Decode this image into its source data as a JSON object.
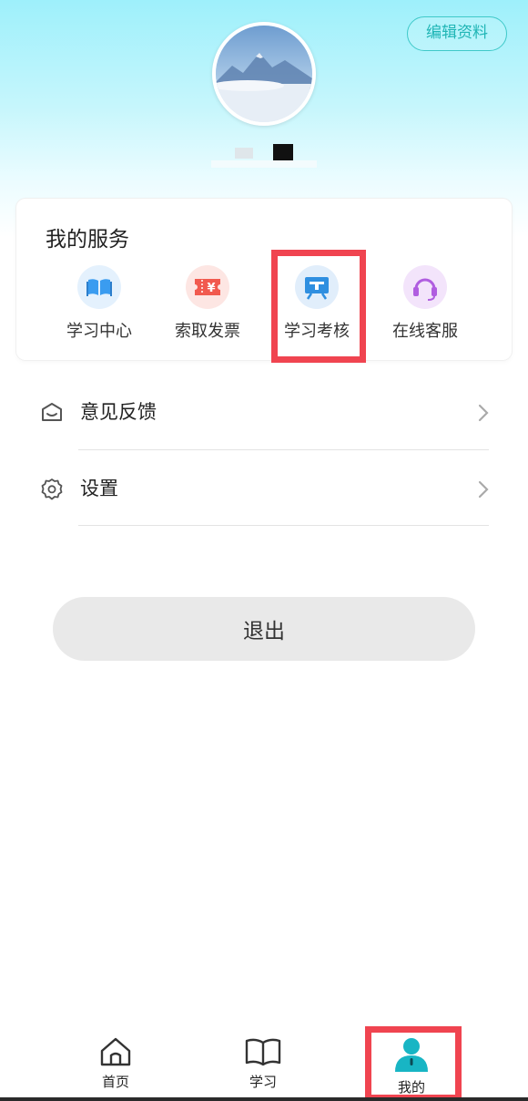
{
  "header": {
    "edit_profile_label": "编辑资料"
  },
  "services": {
    "title": "我的服务",
    "items": [
      {
        "label": "学习中心",
        "icon": "book-icon",
        "color": "#3a9cf0"
      },
      {
        "label": "索取发票",
        "icon": "invoice-ticket-icon",
        "color": "#f15a4f"
      },
      {
        "label": "学习考核",
        "icon": "presentation-board-icon",
        "color": "#2f8fe0"
      },
      {
        "label": "在线客服",
        "icon": "headset-icon",
        "color": "#b05de0"
      }
    ]
  },
  "menu": [
    {
      "label": "意见反馈",
      "icon": "feedback-mail-icon"
    },
    {
      "label": "设置",
      "icon": "gear-icon"
    }
  ],
  "logout_label": "退出",
  "tabbar": {
    "items": [
      {
        "label": "首页",
        "icon": "home-icon"
      },
      {
        "label": "学习",
        "icon": "open-book-icon"
      },
      {
        "label": "我的",
        "icon": "person-icon",
        "active": true
      }
    ]
  },
  "colors": {
    "accent": "#1fb5b5",
    "highlight": "#f04450",
    "active_tab": "#18b5c4"
  }
}
